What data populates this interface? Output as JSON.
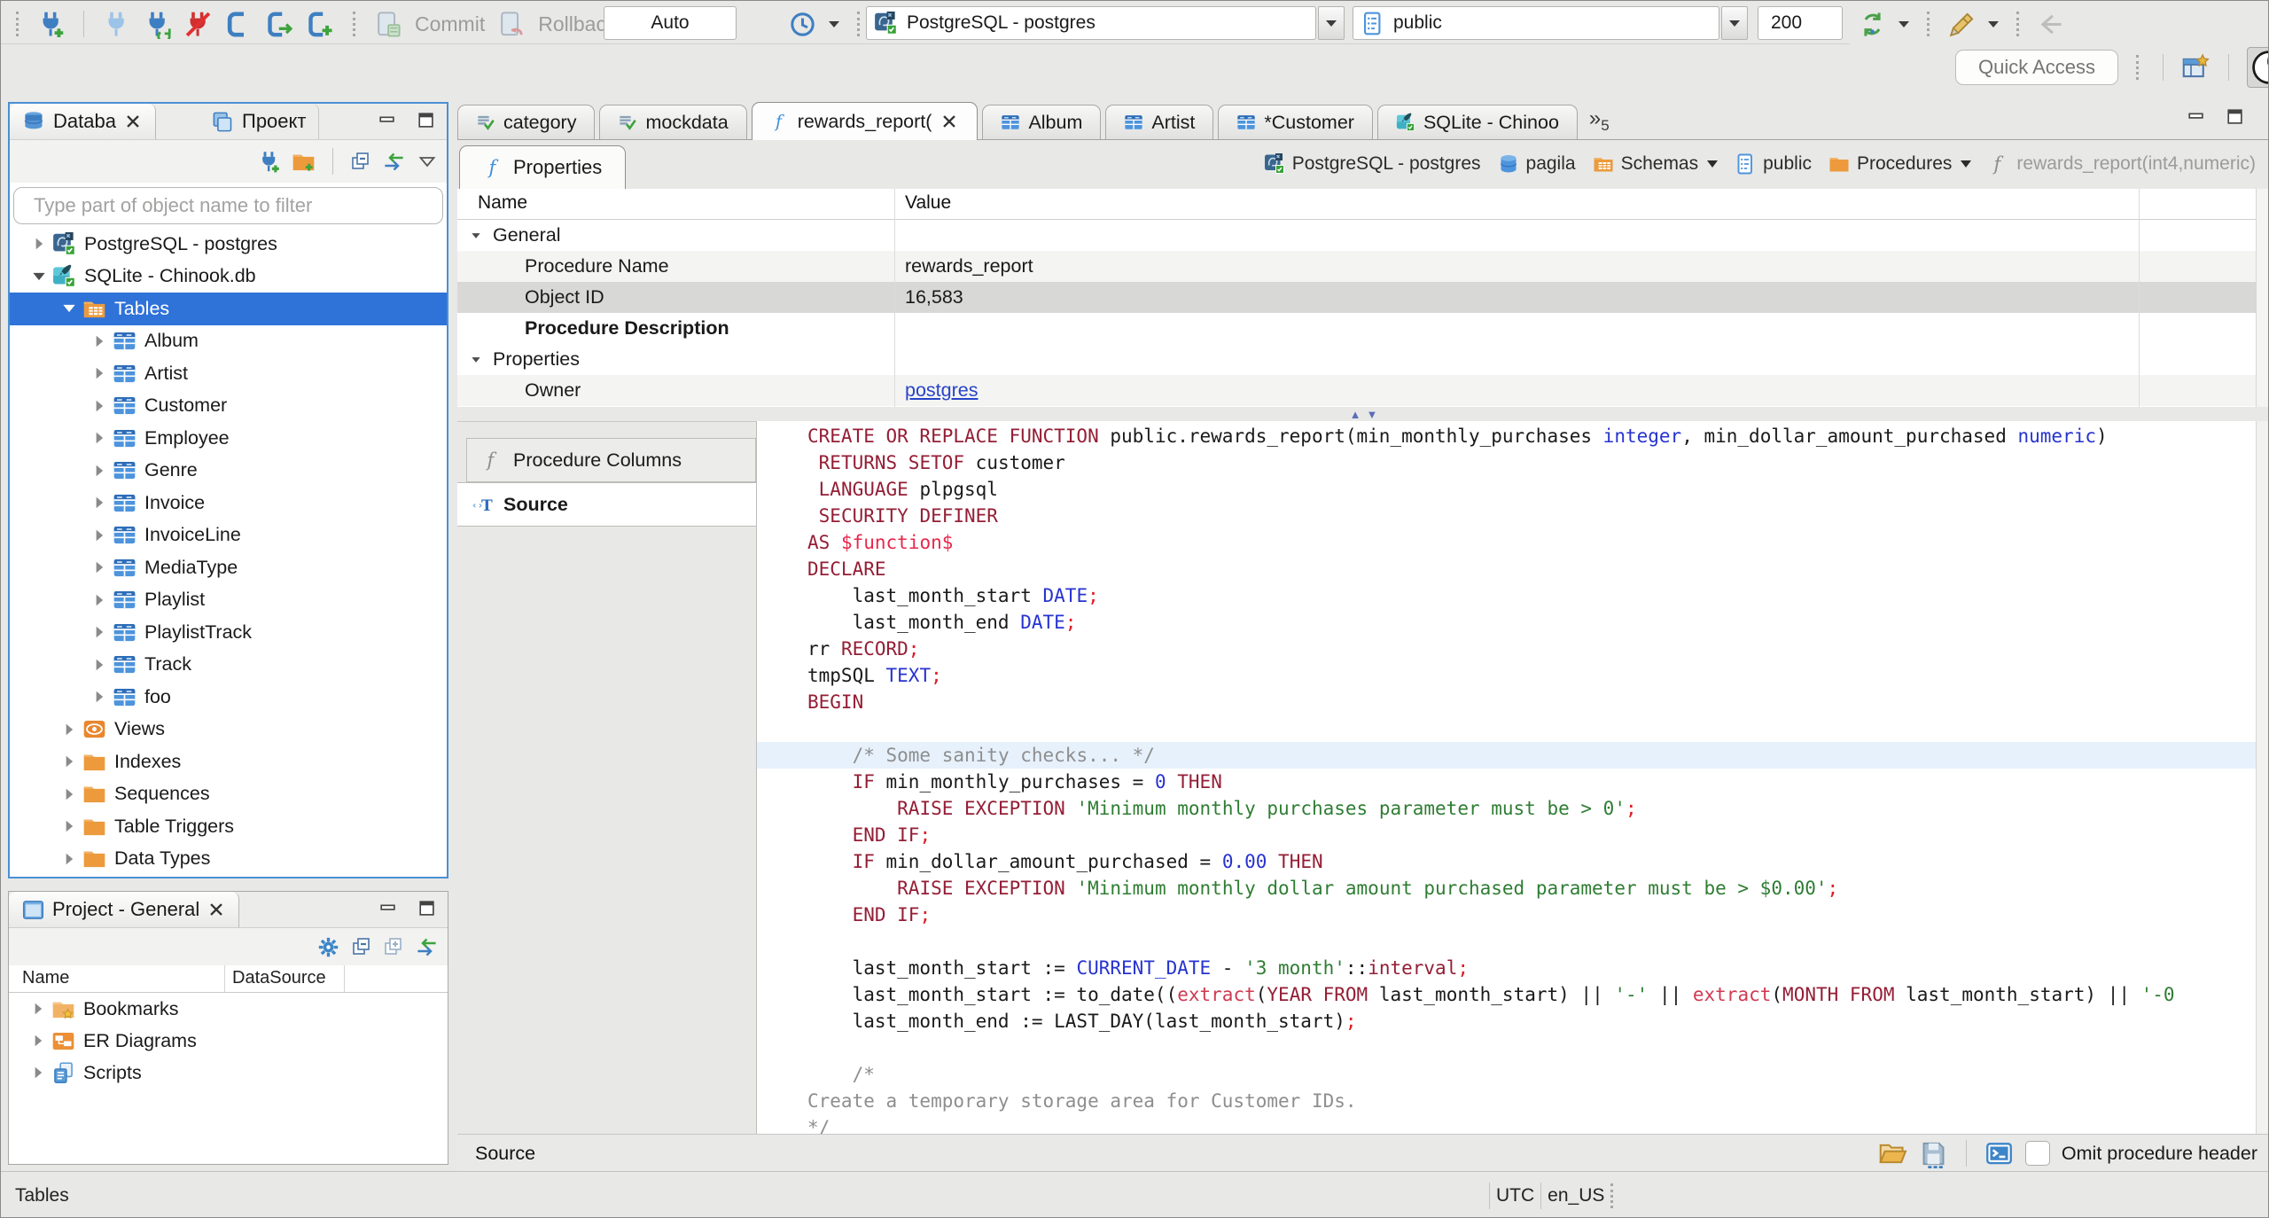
{
  "toolbar": {
    "commit_label": "Commit",
    "rollback_label": "Rollback",
    "auto_label": "Auto",
    "connection_value": "PostgreSQL - postgres",
    "schema_value": "public",
    "fetch_size": "200",
    "quick_access_placeholder": "Quick Access"
  },
  "navigator": {
    "tab_database": "Databa",
    "tab_project": "Проект",
    "filter_placeholder": "Type part of object name to filter",
    "tree": [
      {
        "label": "PostgreSQL - postgres",
        "icon": "postgres-db-icon",
        "level": 0,
        "arrow": "right"
      },
      {
        "label": "SQLite - Chinook.db",
        "icon": "sqlite-db-icon",
        "level": 0,
        "arrow": "down"
      },
      {
        "label": "Tables",
        "icon": "tables-folder-icon",
        "level": 1,
        "arrow": "down",
        "selected": true
      },
      {
        "label": "Album",
        "icon": "table-icon",
        "level": 2,
        "arrow": "right"
      },
      {
        "label": "Artist",
        "icon": "table-icon",
        "level": 2,
        "arrow": "right"
      },
      {
        "label": "Customer",
        "icon": "table-icon",
        "level": 2,
        "arrow": "right"
      },
      {
        "label": "Employee",
        "icon": "table-icon",
        "level": 2,
        "arrow": "right"
      },
      {
        "label": "Genre",
        "icon": "table-icon",
        "level": 2,
        "arrow": "right"
      },
      {
        "label": "Invoice",
        "icon": "table-icon",
        "level": 2,
        "arrow": "right"
      },
      {
        "label": "InvoiceLine",
        "icon": "table-icon",
        "level": 2,
        "arrow": "right"
      },
      {
        "label": "MediaType",
        "icon": "table-icon",
        "level": 2,
        "arrow": "right"
      },
      {
        "label": "Playlist",
        "icon": "table-icon",
        "level": 2,
        "arrow": "right"
      },
      {
        "label": "PlaylistTrack",
        "icon": "table-icon",
        "level": 2,
        "arrow": "right"
      },
      {
        "label": "Track",
        "icon": "table-icon",
        "level": 2,
        "arrow": "right"
      },
      {
        "label": "foo",
        "icon": "table-icon",
        "level": 2,
        "arrow": "right"
      },
      {
        "label": "Views",
        "icon": "views-icon",
        "level": 1,
        "arrow": "right"
      },
      {
        "label": "Indexes",
        "icon": "folder-icon",
        "level": 1,
        "arrow": "right"
      },
      {
        "label": "Sequences",
        "icon": "folder-icon",
        "level": 1,
        "arrow": "right"
      },
      {
        "label": "Table Triggers",
        "icon": "folder-icon",
        "level": 1,
        "arrow": "right"
      },
      {
        "label": "Data Types",
        "icon": "folder-icon",
        "level": 1,
        "arrow": "right"
      }
    ]
  },
  "project_panel": {
    "title": "Project - General",
    "columns": [
      "Name",
      "DataSource"
    ],
    "items": [
      {
        "label": "Bookmarks",
        "icon": "bookmarks-folder-icon"
      },
      {
        "label": "ER Diagrams",
        "icon": "er-diagrams-icon"
      },
      {
        "label": "Scripts",
        "icon": "scripts-icon"
      }
    ]
  },
  "editor": {
    "tabs": [
      {
        "label": "category",
        "icon": "sql-script-icon"
      },
      {
        "label": "mockdata",
        "icon": "sql-script-icon"
      },
      {
        "label": "rewards_report(",
        "icon": "function-icon",
        "active": true,
        "closable": true
      },
      {
        "label": "Album",
        "icon": "table-icon"
      },
      {
        "label": "Artist",
        "icon": "table-icon"
      },
      {
        "label": "*Customer",
        "icon": "table-icon"
      },
      {
        "label": "SQLite - Chinoo",
        "icon": "sqlite-db-icon"
      }
    ],
    "overflow_count": "5",
    "properties_tab_label": "Properties",
    "breadcrumb": [
      {
        "label": "PostgreSQL - postgres",
        "icon": "postgres-db-icon"
      },
      {
        "label": "pagila",
        "icon": "database-icon"
      },
      {
        "label": "Schemas",
        "icon": "schemas-folder-icon",
        "dropdown": true
      },
      {
        "label": "public",
        "icon": "schema-icon"
      },
      {
        "label": "Procedures",
        "icon": "folder-icon",
        "dropdown": true
      },
      {
        "label": "rewards_report(int4,numeric)",
        "icon": "function-gray-icon",
        "muted": true
      }
    ],
    "properties": {
      "columns": [
        "Name",
        "Value"
      ],
      "rows": [
        {
          "name": "General",
          "value": "",
          "group": true
        },
        {
          "name": "Procedure Name",
          "value": "rewards_report",
          "zebra": true
        },
        {
          "name": "Object ID",
          "value": "16,583",
          "selected": true
        },
        {
          "name": "Procedure Description",
          "value": "",
          "bold": true
        },
        {
          "name": "Properties",
          "value": "",
          "group": true
        },
        {
          "name": "Owner",
          "value": "postgres",
          "link": true,
          "zebra": true
        }
      ]
    },
    "side_tabs": [
      {
        "label": "Procedure Columns",
        "icon": "function-gray-icon"
      },
      {
        "label": "Source",
        "icon": "source-icon",
        "active": true
      }
    ],
    "code_lines": [
      {
        "segs": [
          {
            "t": "CREATE OR REPLACE FUNCTION ",
            "c": "sk"
          },
          {
            "t": "public.rewards_report(min_monthly_purchases ",
            "c": ""
          },
          {
            "t": "integer",
            "c": "st"
          },
          {
            "t": ", min_dollar_amount_purchased ",
            "c": ""
          },
          {
            "t": "numeric",
            "c": "st"
          },
          {
            "t": ")",
            "c": ""
          }
        ]
      },
      {
        "segs": [
          {
            "t": " ",
            "c": ""
          },
          {
            "t": "RETURNS SETOF ",
            "c": "sk"
          },
          {
            "t": "customer",
            "c": ""
          }
        ]
      },
      {
        "segs": [
          {
            "t": " ",
            "c": ""
          },
          {
            "t": "LANGUAGE ",
            "c": "sk"
          },
          {
            "t": "plpgsql",
            "c": ""
          }
        ]
      },
      {
        "segs": [
          {
            "t": " ",
            "c": ""
          },
          {
            "t": "SECURITY DEFINER",
            "c": "sk"
          }
        ]
      },
      {
        "segs": [
          {
            "t": "AS ",
            "c": "sk"
          },
          {
            "t": "$function$",
            "c": "sd"
          }
        ]
      },
      {
        "segs": [
          {
            "t": "DECLARE",
            "c": "sk"
          }
        ]
      },
      {
        "segs": [
          {
            "t": "    last_month_start ",
            "c": ""
          },
          {
            "t": "DATE",
            "c": "st"
          },
          {
            "t": ";",
            "c": "sp"
          }
        ]
      },
      {
        "segs": [
          {
            "t": "    last_month_end ",
            "c": ""
          },
          {
            "t": "DATE",
            "c": "st"
          },
          {
            "t": ";",
            "c": "sp"
          }
        ]
      },
      {
        "segs": [
          {
            "t": "rr ",
            "c": ""
          },
          {
            "t": "RECORD",
            "c": "sk"
          },
          {
            "t": ";",
            "c": "sp"
          }
        ]
      },
      {
        "segs": [
          {
            "t": "tmpSQL ",
            "c": ""
          },
          {
            "t": "TEXT",
            "c": "st"
          },
          {
            "t": ";",
            "c": "sp"
          }
        ]
      },
      {
        "segs": [
          {
            "t": "BEGIN",
            "c": "sk"
          }
        ]
      },
      {
        "segs": []
      },
      {
        "hl": true,
        "segs": [
          {
            "t": "    ",
            "c": ""
          },
          {
            "t": "/* Some sanity checks... */",
            "c": "scm"
          }
        ]
      },
      {
        "segs": [
          {
            "t": "    ",
            "c": ""
          },
          {
            "t": "IF",
            "c": "sk"
          },
          {
            "t": " min_monthly_purchases = ",
            "c": ""
          },
          {
            "t": "0",
            "c": "sn"
          },
          {
            "t": " ",
            "c": ""
          },
          {
            "t": "THEN",
            "c": "sk"
          }
        ]
      },
      {
        "segs": [
          {
            "t": "        ",
            "c": ""
          },
          {
            "t": "RAISE EXCEPTION ",
            "c": "sk"
          },
          {
            "t": "'Minimum monthly purchases parameter must be > 0'",
            "c": "ss"
          },
          {
            "t": ";",
            "c": "sp"
          }
        ]
      },
      {
        "segs": [
          {
            "t": "    ",
            "c": ""
          },
          {
            "t": "END IF",
            "c": "sk"
          },
          {
            "t": ";",
            "c": "sp"
          }
        ]
      },
      {
        "segs": [
          {
            "t": "    ",
            "c": ""
          },
          {
            "t": "IF",
            "c": "sk"
          },
          {
            "t": " min_dollar_amount_purchased = ",
            "c": ""
          },
          {
            "t": "0.00",
            "c": "sn"
          },
          {
            "t": " ",
            "c": ""
          },
          {
            "t": "THEN",
            "c": "sk"
          }
        ]
      },
      {
        "segs": [
          {
            "t": "        ",
            "c": ""
          },
          {
            "t": "RAISE EXCEPTION ",
            "c": "sk"
          },
          {
            "t": "'Minimum monthly dollar amount purchased parameter must be > $0.00'",
            "c": "ss"
          },
          {
            "t": ";",
            "c": "sp"
          }
        ]
      },
      {
        "segs": [
          {
            "t": "    ",
            "c": ""
          },
          {
            "t": "END IF",
            "c": "sk"
          },
          {
            "t": ";",
            "c": "sp"
          }
        ]
      },
      {
        "segs": []
      },
      {
        "segs": [
          {
            "t": "    last_month_start := ",
            "c": ""
          },
          {
            "t": "CURRENT_DATE",
            "c": "st"
          },
          {
            "t": " - ",
            "c": ""
          },
          {
            "t": "'3 month'",
            "c": "ss"
          },
          {
            "t": "::",
            "c": ""
          },
          {
            "t": "interval",
            "c": "sk"
          },
          {
            "t": ";",
            "c": "sp"
          }
        ]
      },
      {
        "segs": [
          {
            "t": "    last_month_start := to_date((",
            "c": ""
          },
          {
            "t": "extract",
            "c": "sf"
          },
          {
            "t": "(",
            "c": ""
          },
          {
            "t": "YEAR FROM",
            "c": "sk"
          },
          {
            "t": " last_month_start) || ",
            "c": ""
          },
          {
            "t": "'-'",
            "c": "ss"
          },
          {
            "t": " || ",
            "c": ""
          },
          {
            "t": "extract",
            "c": "sf"
          },
          {
            "t": "(",
            "c": ""
          },
          {
            "t": "MONTH FROM",
            "c": "sk"
          },
          {
            "t": " last_month_start) || ",
            "c": ""
          },
          {
            "t": "'-0",
            "c": "ss"
          }
        ]
      },
      {
        "segs": [
          {
            "t": "    last_month_end := LAST_DAY(last_month_start)",
            "c": ""
          },
          {
            "t": ";",
            "c": "sp"
          }
        ]
      },
      {
        "segs": []
      },
      {
        "segs": [
          {
            "t": "    ",
            "c": ""
          },
          {
            "t": "/*",
            "c": "scm"
          }
        ]
      },
      {
        "segs": [
          {
            "t": "Create a temporary storage area for Customer IDs.",
            "c": "scm"
          }
        ]
      },
      {
        "segs": [
          {
            "t": "*/",
            "c": "scm"
          }
        ]
      }
    ],
    "bottom": {
      "label": "Source",
      "omit_checkbox_label": "Omit procedure header"
    }
  },
  "status_bar": {
    "left": "Tables",
    "timezone": "UTC",
    "locale": "en_US"
  }
}
